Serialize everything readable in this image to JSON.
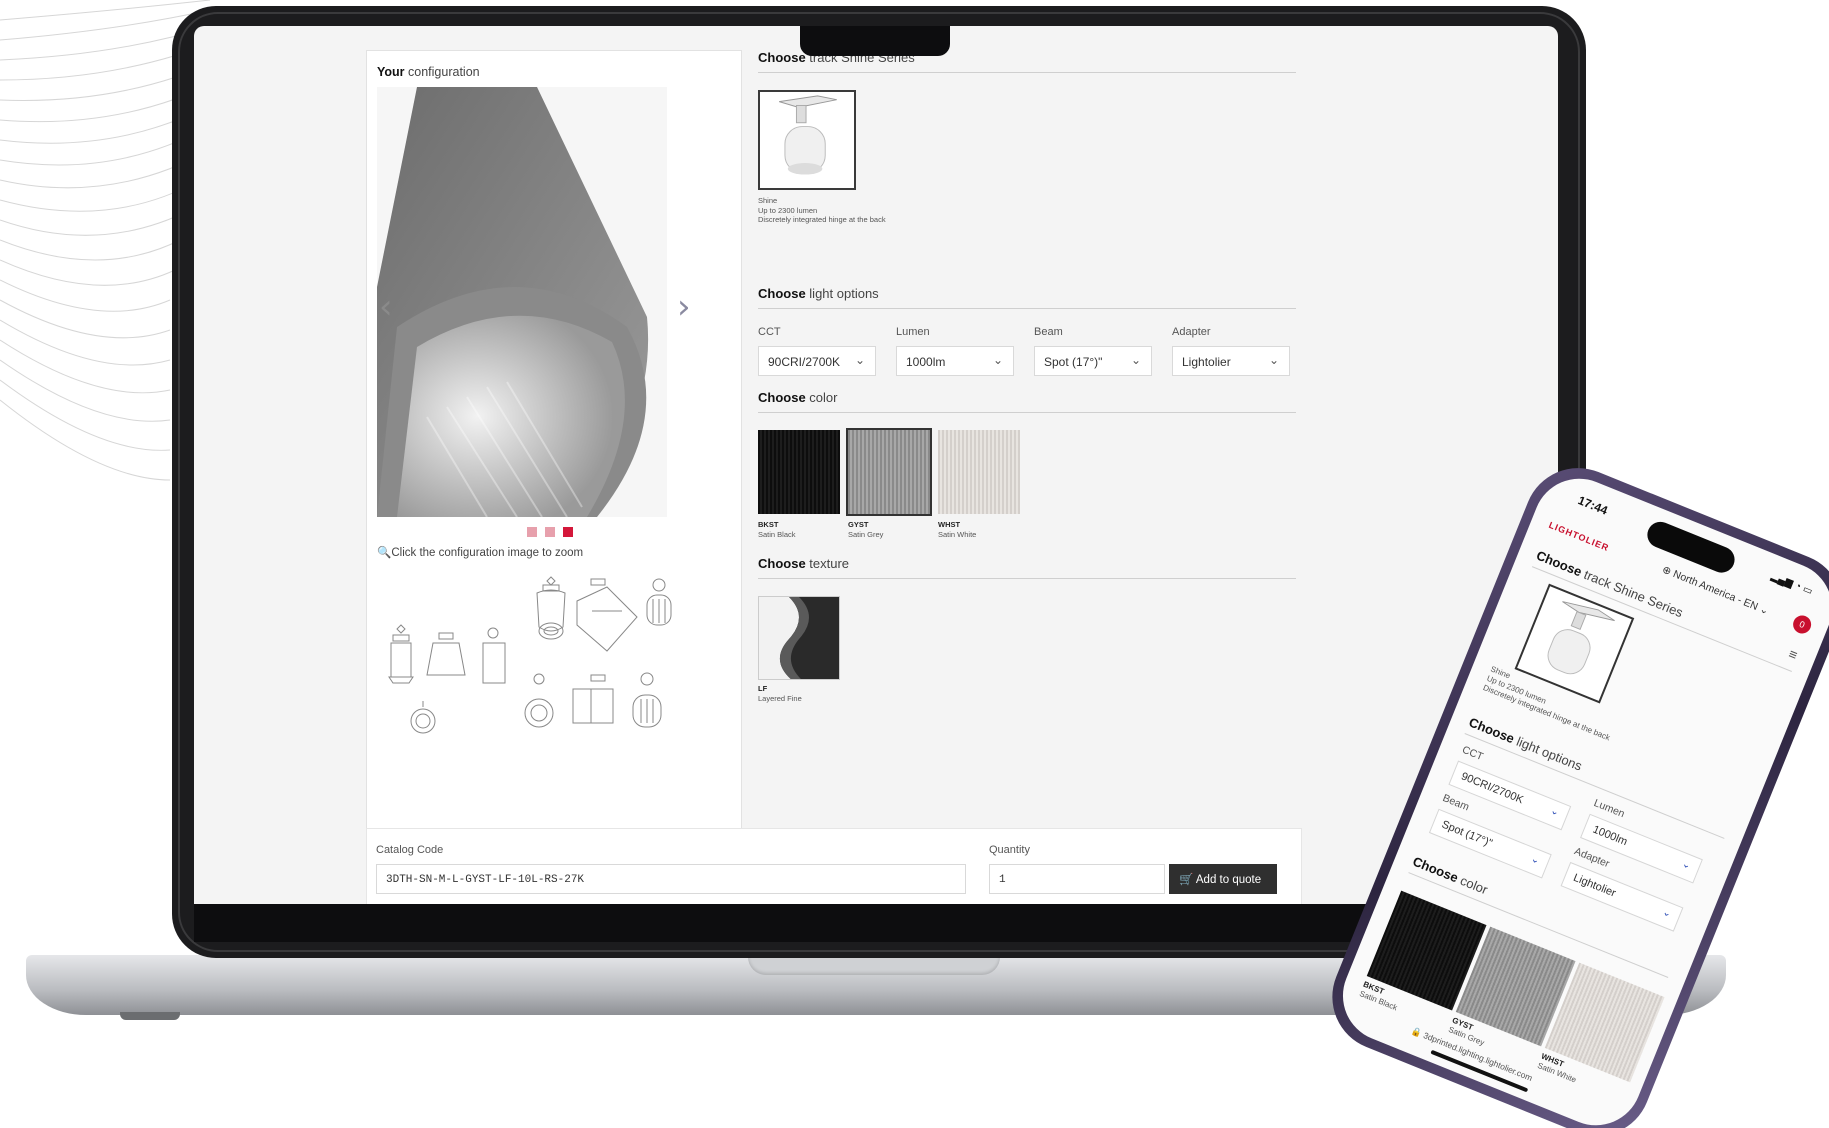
{
  "desktop": {
    "config_title_bold": "Your",
    "config_title_rest": "configuration",
    "zoom_hint": "Click the configuration image to zoom",
    "track_section": {
      "bold": "Choose",
      "rest": "track Shine Series"
    },
    "track_option": {
      "name": "Shine",
      "line1": "Up to 2300 lumen",
      "line2": "Discretely integrated hinge at the back"
    },
    "light_section": {
      "bold": "Choose",
      "rest": "light options"
    },
    "options": {
      "cct": {
        "label": "CCT",
        "value": "90CRI/2700K"
      },
      "lumen": {
        "label": "Lumen",
        "value": "1000lm"
      },
      "beam": {
        "label": "Beam",
        "value": "Spot (17°)\""
      },
      "adapter": {
        "label": "Adapter",
        "value": "Lightolier"
      }
    },
    "color_section": {
      "bold": "Choose",
      "rest": "color"
    },
    "colors": [
      {
        "code": "BKST",
        "name": "Satin Black"
      },
      {
        "code": "GYST",
        "name": "Satin Grey"
      },
      {
        "code": "WHST",
        "name": "Satin White"
      }
    ],
    "texture_section": {
      "bold": "Choose",
      "rest": "texture"
    },
    "texture": {
      "code": "LF",
      "name": "Layered Fine"
    },
    "catalog_label": "Catalog Code",
    "catalog_value": "3DTH-SN-M-L-GYST-LF-10L-RS-27K",
    "quantity_label": "Quantity",
    "quantity_value": "1",
    "add_button": "Add to quote"
  },
  "phone": {
    "time": "17:44",
    "logo": "LIGHTOLIER",
    "region": "North America - EN",
    "track_title": {
      "bold": "Choose",
      "rest": "track Shine Series"
    },
    "track_option": {
      "name": "Shine",
      "line1": "Up to 2300 lumen",
      "line2": "Discretely integrated hinge at the back"
    },
    "light_title": {
      "bold": "Choose",
      "rest": "light options"
    },
    "cct_label": "CCT",
    "cct_value": "90CRI/2700K",
    "lumen_label": "Lumen",
    "lumen_value": "1000lm",
    "beam_label": "Beam",
    "beam_value": "Spot (17°)\"",
    "adapter_label": "Adapter",
    "adapter_value": "Lightolier",
    "color_title": {
      "bold": "Choose",
      "rest": "color"
    },
    "colors": [
      {
        "code": "BKST",
        "name": "Satin Black"
      },
      {
        "code": "GYST",
        "name": "Satin Grey"
      },
      {
        "code": "WHST",
        "name": "Satin White"
      }
    ],
    "url": "3dprinted.lighting.lightolier.com"
  },
  "colors": {
    "accent": "#d4173a",
    "brand": "#c8102e",
    "button": "#2f2f2f",
    "phone_frame": "#3b3150"
  },
  "icons": [
    "zoom-icon",
    "cart-icon",
    "chevron-down-icon",
    "chevron-right-icon",
    "globe-icon",
    "menu-icon",
    "lock-icon"
  ]
}
